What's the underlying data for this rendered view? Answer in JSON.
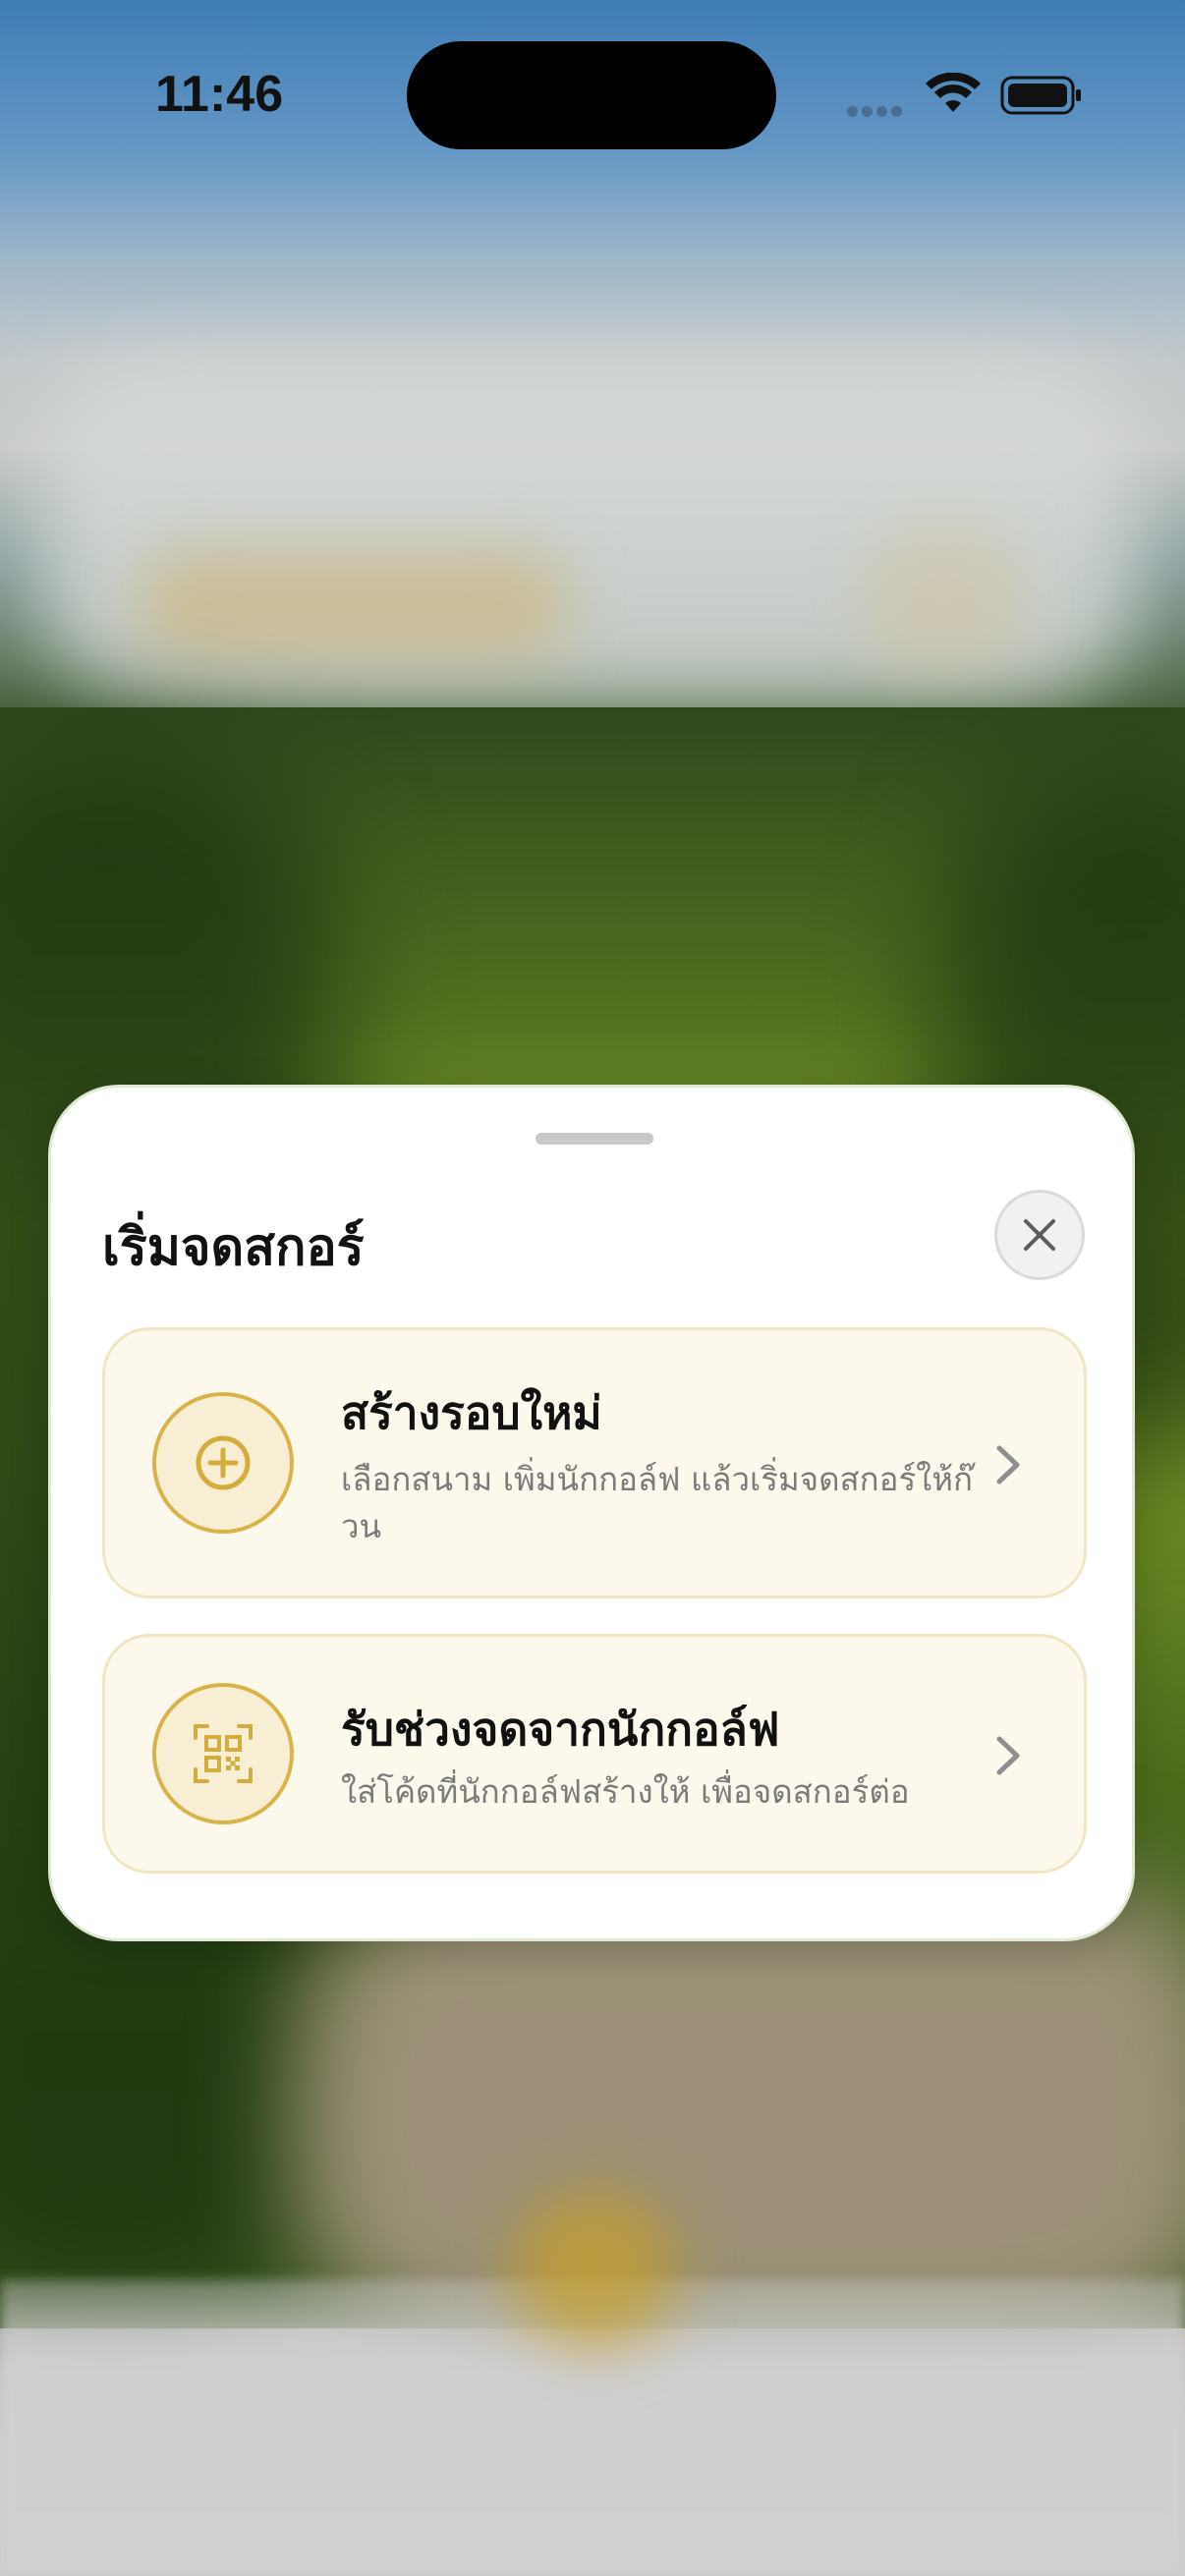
{
  "status_bar": {
    "time": "11:46"
  },
  "sheet": {
    "title": "เริ่มจดสกอร์",
    "close_icon": "close-icon",
    "options": [
      {
        "icon": "plus-circle-icon",
        "title": "สร้างรอบใหม่",
        "description": "เลือกสนาม เพิ่มนักกอล์ฟ แล้วเริ่มจดสกอร์ให้ก๊วน"
      },
      {
        "icon": "qr-code-icon",
        "title": "รับช่วงจดจากนักกอล์ฟ",
        "description": "ใส่โค้ดที่นักกอล์ฟสร้างให้ เพื่อจดสกอร์ต่อ"
      }
    ]
  },
  "colors": {
    "accent_gold": "#d8b448",
    "card_background": "#fcf9ec",
    "card_border": "#f0e6c2"
  }
}
